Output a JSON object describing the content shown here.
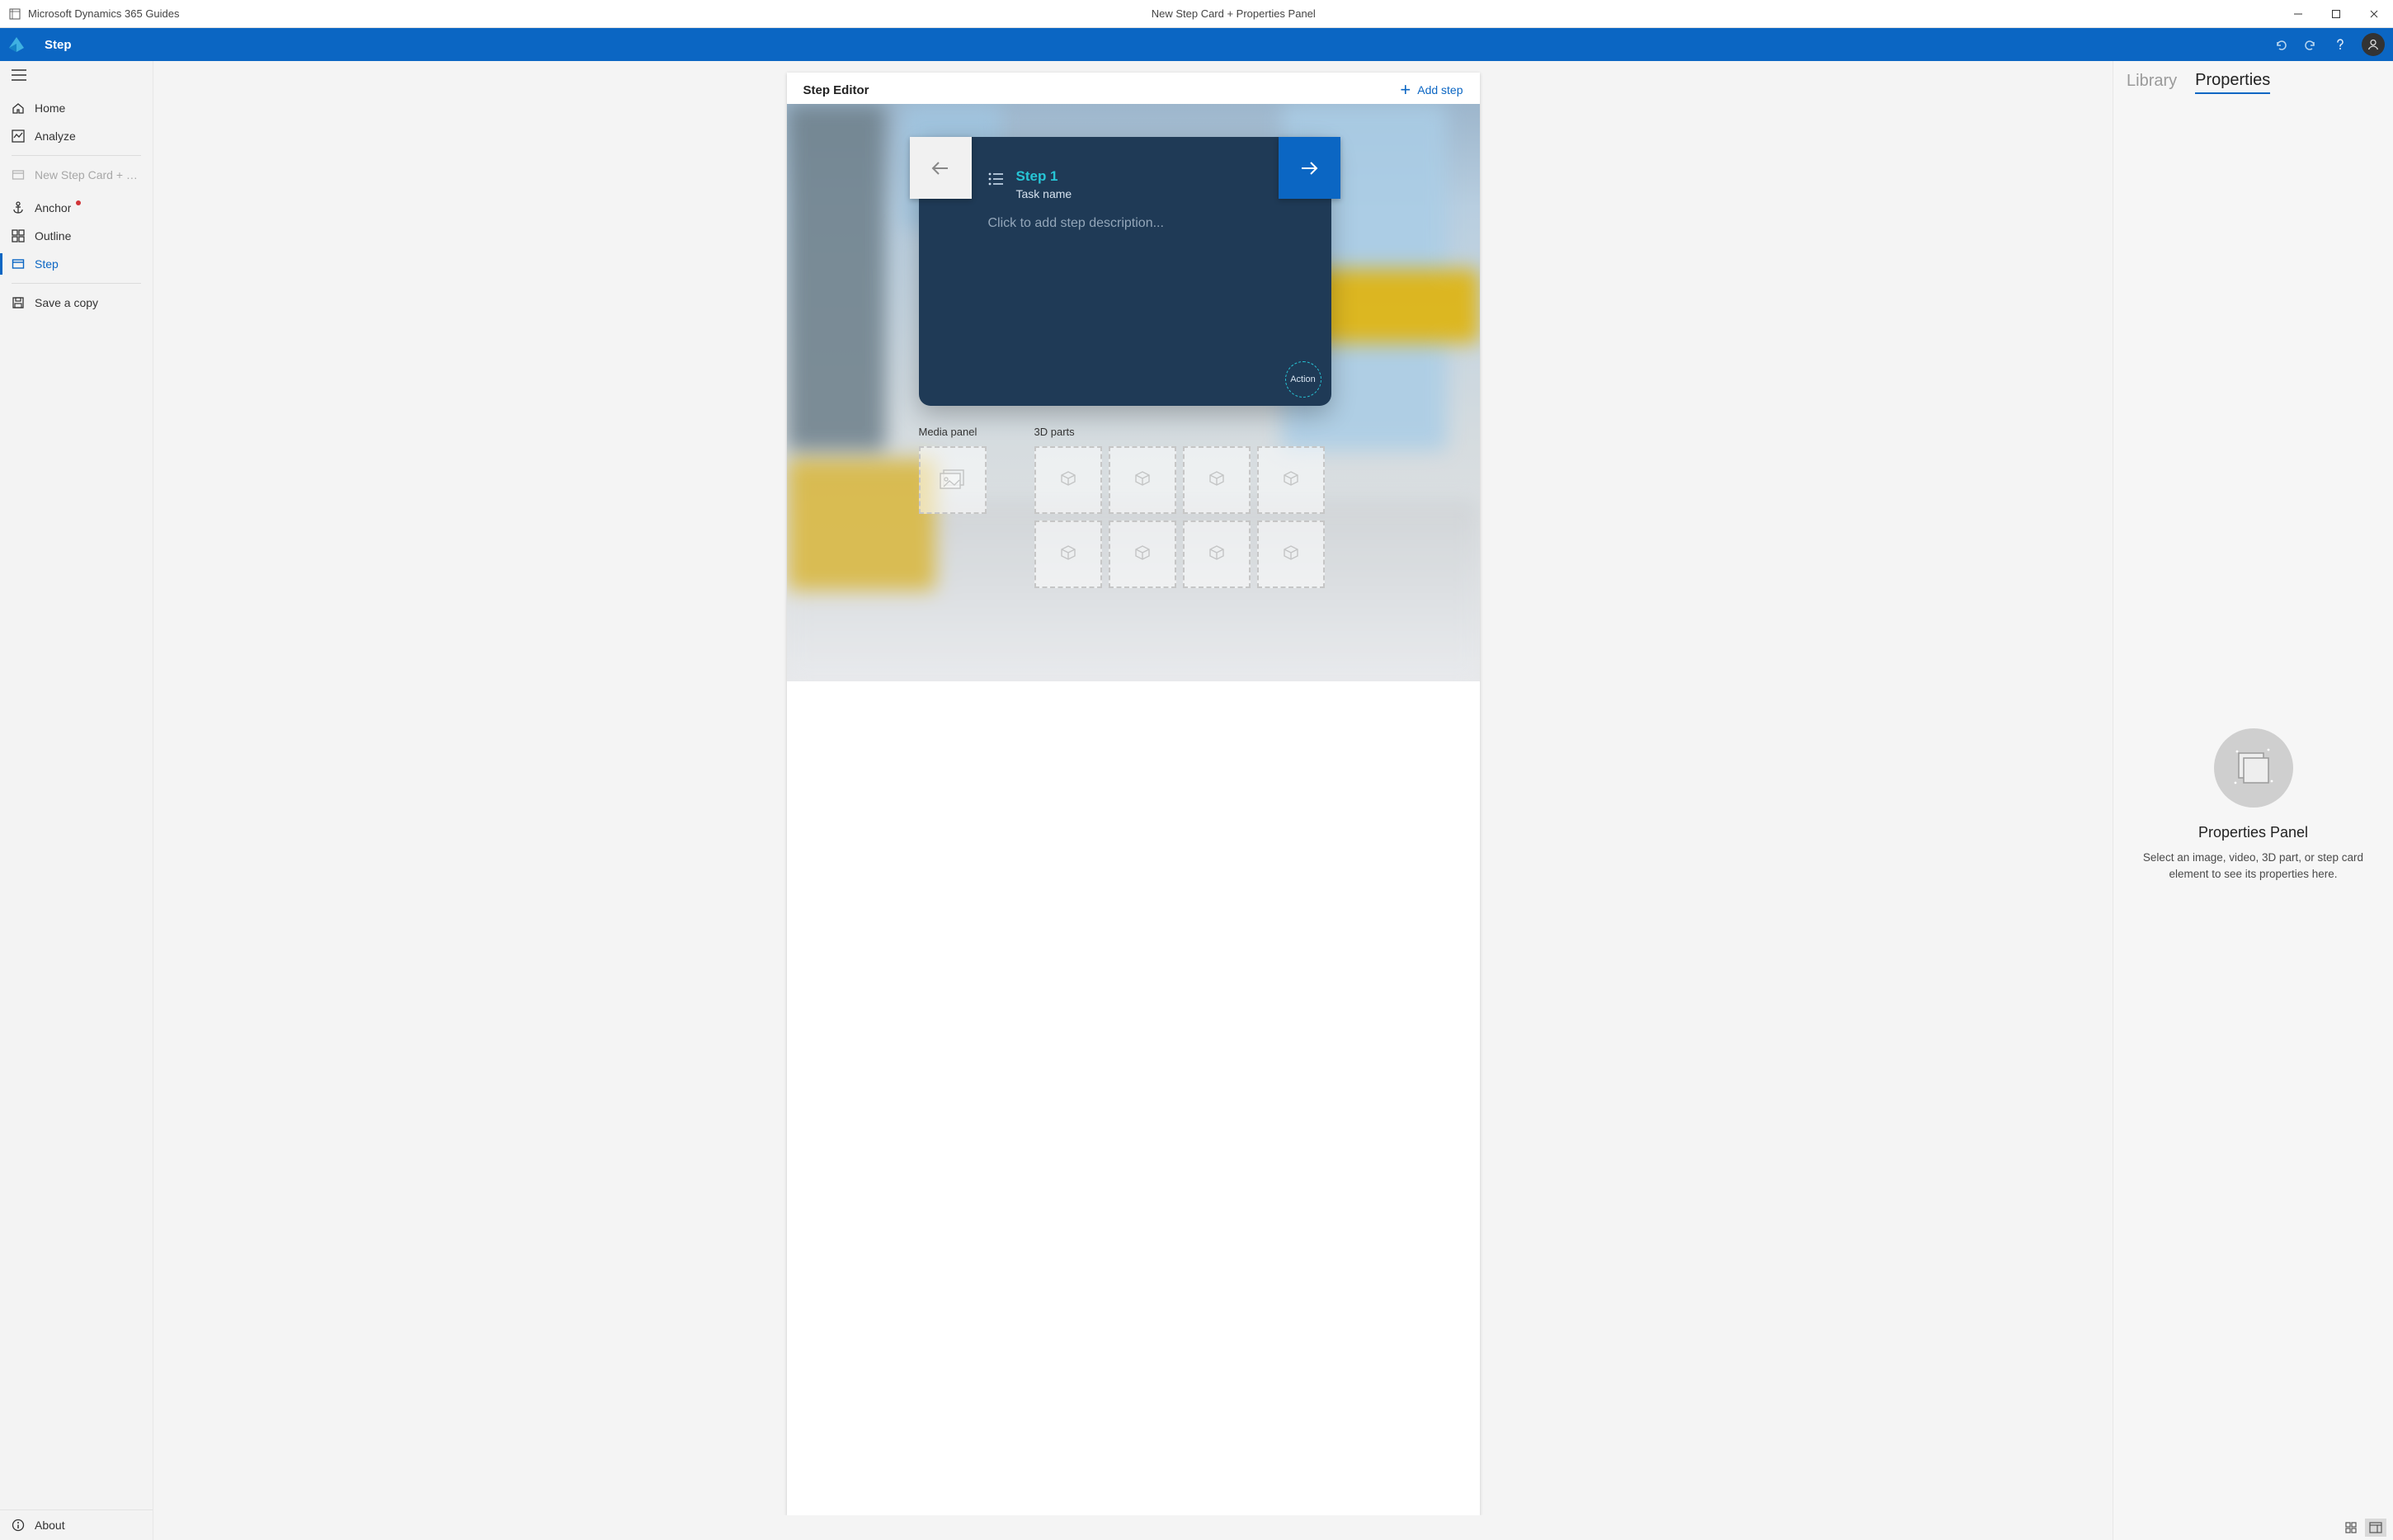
{
  "titlebar": {
    "app_title": "Microsoft Dynamics 365 Guides",
    "doc_title": "New Step Card + Properties Panel"
  },
  "ribbon": {
    "breadcrumb": "Step"
  },
  "sidebar": {
    "home": "Home",
    "analyze": "Analyze",
    "doc_item": "New Step Card + Pr…",
    "anchor": "Anchor",
    "outline": "Outline",
    "step": "Step",
    "save_copy": "Save a copy",
    "about": "About"
  },
  "editor": {
    "title": "Step Editor",
    "add_step": "Add step",
    "step_card": {
      "title": "Step 1",
      "task_name": "Task name",
      "desc_placeholder": "Click to add step description...",
      "action": "Action"
    },
    "media_label": "Media panel",
    "parts_label": "3D parts"
  },
  "panel": {
    "tab_library": "Library",
    "tab_properties": "Properties",
    "empty_title": "Properties Panel",
    "empty_sub": "Select an image, video, 3D part, or step card element to see its properties here."
  }
}
